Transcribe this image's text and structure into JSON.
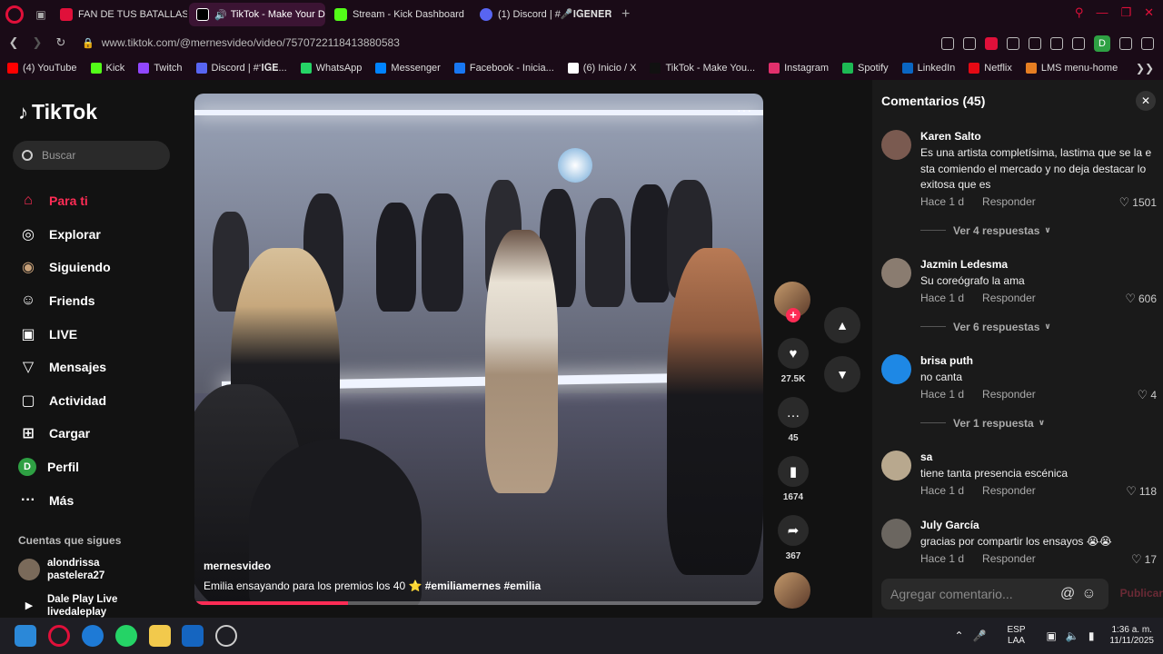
{
  "browser": {
    "tabs": [
      {
        "label": "FAN DE TUS BATALLAS -",
        "color": "#e0103a",
        "active": false
      },
      {
        "label": "TikTok - Make Your D",
        "color": "#ffffff",
        "active": true
      },
      {
        "label": "Stream - Kick Dashboard",
        "color": "#53fc18",
        "active": false
      },
      {
        "label": "(1) Discord | #🎤𝐈𝐆𝐄𝐍𝐄𝐑",
        "color": "#5865f2",
        "active": false
      }
    ],
    "new_tab": "+",
    "url": "www.tiktok.com/@mernesvideo/video/7570722118413880583",
    "profile_initial": "D"
  },
  "bookmarks": [
    {
      "label": "(4) YouTube",
      "color": "#ff0000"
    },
    {
      "label": "Kick",
      "color": "#53fc18"
    },
    {
      "label": "Twitch",
      "color": "#9146ff"
    },
    {
      "label": "Discord | #‘𝐈𝐆𝐄...",
      "color": "#5865f2"
    },
    {
      "label": "WhatsApp",
      "color": "#25d366"
    },
    {
      "label": "Messenger",
      "color": "#0084ff"
    },
    {
      "label": "Facebook - Inicia...",
      "color": "#1877f2"
    },
    {
      "label": "(6) Inicio / X",
      "color": "#ffffff"
    },
    {
      "label": "TikTok - Make You...",
      "color": "#111111"
    },
    {
      "label": "Instagram",
      "color": "#e1306c"
    },
    {
      "label": "Spotify",
      "color": "#1db954"
    },
    {
      "label": "LinkedIn",
      "color": "#0a66c2"
    },
    {
      "label": "Netflix",
      "color": "#e50914"
    },
    {
      "label": "LMS menu-home",
      "color": "#e67e22"
    }
  ],
  "sidebar": {
    "logo": "TikTok",
    "search_placeholder": "Buscar",
    "items": [
      {
        "label": "Para ti",
        "icon": "home-icon",
        "glyph": "⌂",
        "active": true
      },
      {
        "label": "Explorar",
        "icon": "compass-icon",
        "glyph": "◎",
        "active": false
      },
      {
        "label": "Siguiendo",
        "icon": "following-avatar-icon",
        "glyph": "◉",
        "active": false
      },
      {
        "label": "Friends",
        "icon": "friends-icon",
        "glyph": "☺",
        "active": false
      },
      {
        "label": "LIVE",
        "icon": "live-icon",
        "glyph": "▣",
        "active": false
      },
      {
        "label": "Mensajes",
        "icon": "messages-icon",
        "glyph": "▽",
        "active": false
      },
      {
        "label": "Actividad",
        "icon": "activity-icon",
        "glyph": "▢",
        "active": false
      },
      {
        "label": "Cargar",
        "icon": "upload-icon",
        "glyph": "⊞",
        "active": false
      },
      {
        "label": "Perfil",
        "icon": "profile-icon",
        "glyph": "D",
        "active": false
      },
      {
        "label": "Más",
        "icon": "more-icon",
        "glyph": "···",
        "active": false
      }
    ],
    "following_title": "Cuentas que sigues",
    "following": [
      {
        "name": "alondrissa",
        "handle": "pastelera27"
      },
      {
        "name": "Dale Play Live",
        "handle": "livedaleplay"
      }
    ]
  },
  "video": {
    "username": "mernesvideo",
    "caption": "Emilia ensayando para los premios los 40 ⭐",
    "hashtags": [
      "#emiliamernes",
      "#emilia"
    ],
    "more": "···",
    "progress": 0.27
  },
  "actions": {
    "likes": "27.5K",
    "comments": "45",
    "saves": "1674",
    "shares": "367"
  },
  "comments_panel": {
    "title": "Comentarios (45)",
    "input_placeholder": "Agregar comentario...",
    "post_label": "Publicar",
    "items": [
      {
        "user": "Karen Salto",
        "text": "Es una artista completísima, lastima que se la e sta comiendo el mercado y no deja destacar lo exitosa que es",
        "time": "Hace 1 d",
        "reply": "Responder",
        "likes": "1501",
        "more_replies": "Ver 4 respuestas"
      },
      {
        "user": "Jazmin Ledesma",
        "text": "Su coreógrafo la ama",
        "time": "Hace 1 d",
        "reply": "Responder",
        "likes": "606",
        "more_replies": "Ver 6 respuestas"
      },
      {
        "user": "brisa puth",
        "text": "no canta",
        "time": "Hace 1 d",
        "reply": "Responder",
        "likes": "4",
        "more_replies": "Ver 1 respuesta"
      },
      {
        "user": "sa",
        "text": "tiene tanta presencia escénica",
        "time": "Hace 1 d",
        "reply": "Responder",
        "likes": "118",
        "more_replies": ""
      },
      {
        "user": "July García",
        "text": "gracias por compartir los ensayos 😭😭",
        "time": "Hace 1 d",
        "reply": "Responder",
        "likes": "17",
        "more_replies": ""
      }
    ]
  },
  "taskbar": {
    "lang_top": "ESP",
    "lang_bottom": "LAA",
    "time": "1:36 a. m.",
    "date": "11/11/2025"
  }
}
